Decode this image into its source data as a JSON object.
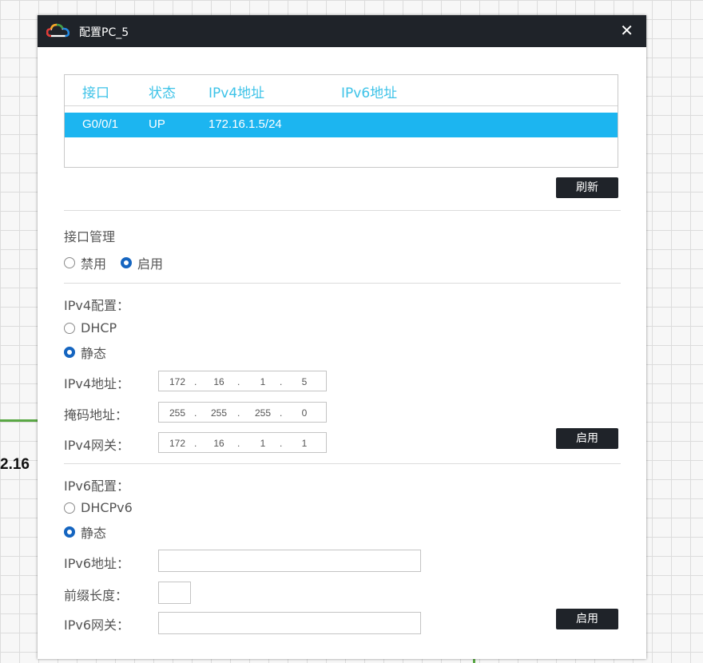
{
  "background": {
    "partial_text": "2.16"
  },
  "window": {
    "title": "配置PC_5",
    "close_symbol": "✕",
    "logo_icon": "cloud-icon"
  },
  "interfaces": {
    "columns": [
      "接口",
      "状态",
      "IPv4地址",
      "IPv6地址"
    ],
    "rows": [
      {
        "port": "G0/0/1",
        "status": "UP",
        "ipv4": "172.16.1.5/24",
        "ipv6": ""
      }
    ],
    "selected_row_color": "#1cb5f0",
    "header_color": "#3ec3e8"
  },
  "refresh_button": "刷新",
  "interface_mgmt": {
    "label": "接口管理",
    "options": [
      "禁用",
      "启用"
    ],
    "selected": "启用"
  },
  "ipv4": {
    "label": "IPv4配置：",
    "modes": [
      "DHCP",
      "静态"
    ],
    "selected_mode": "静态",
    "address_label": "IPv4地址：",
    "address": [
      "172",
      "16",
      "1",
      "5"
    ],
    "mask_label": "掩码地址：",
    "mask": [
      "255",
      "255",
      "255",
      "0"
    ],
    "gateway_label": "IPv4网关：",
    "gateway": [
      "172",
      "16",
      "1",
      "1"
    ],
    "apply_button": "启用"
  },
  "ipv6": {
    "label": "IPv6配置：",
    "modes": [
      "DHCPv6",
      "静态"
    ],
    "selected_mode": "静态",
    "address_label": "IPv6地址：",
    "address": "",
    "prefix_label": "前缀长度：",
    "prefix": "",
    "gateway_label": "IPv6网关：",
    "gateway": "",
    "apply_button": "启用"
  },
  "colors": {
    "titlebar": "#1f2329",
    "radio_selected": "#1565c0"
  }
}
